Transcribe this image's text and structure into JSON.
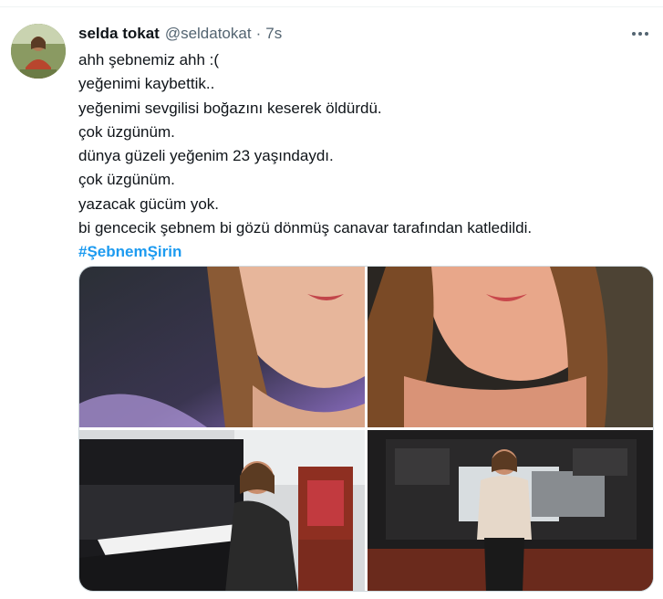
{
  "tweet": {
    "author_name": "selda tokat",
    "handle": "@seldatokat",
    "separator": "·",
    "time": "7s",
    "more_icon": "more-horizontal-icon",
    "lines": [
      "ahh şebnemiz ahh :(",
      "yeğenimi kaybettik..",
      "yeğenimi sevgilisi boğazını keserek öldürdü.",
      "çok üzgünüm.",
      "dünya güzeli yeğenim 23 yaşındaydı.",
      "çok üzgünüm.",
      "yazacak gücüm yok.",
      "bi gencecik şebnem bi gözü dönmüş canavar tarafından katledildi."
    ],
    "hashtag": "#ŞebnemŞirin"
  },
  "colors": {
    "text": "#0f1419",
    "secondary": "#536471",
    "link": "#1d9bf0",
    "border": "#cfd9de"
  }
}
